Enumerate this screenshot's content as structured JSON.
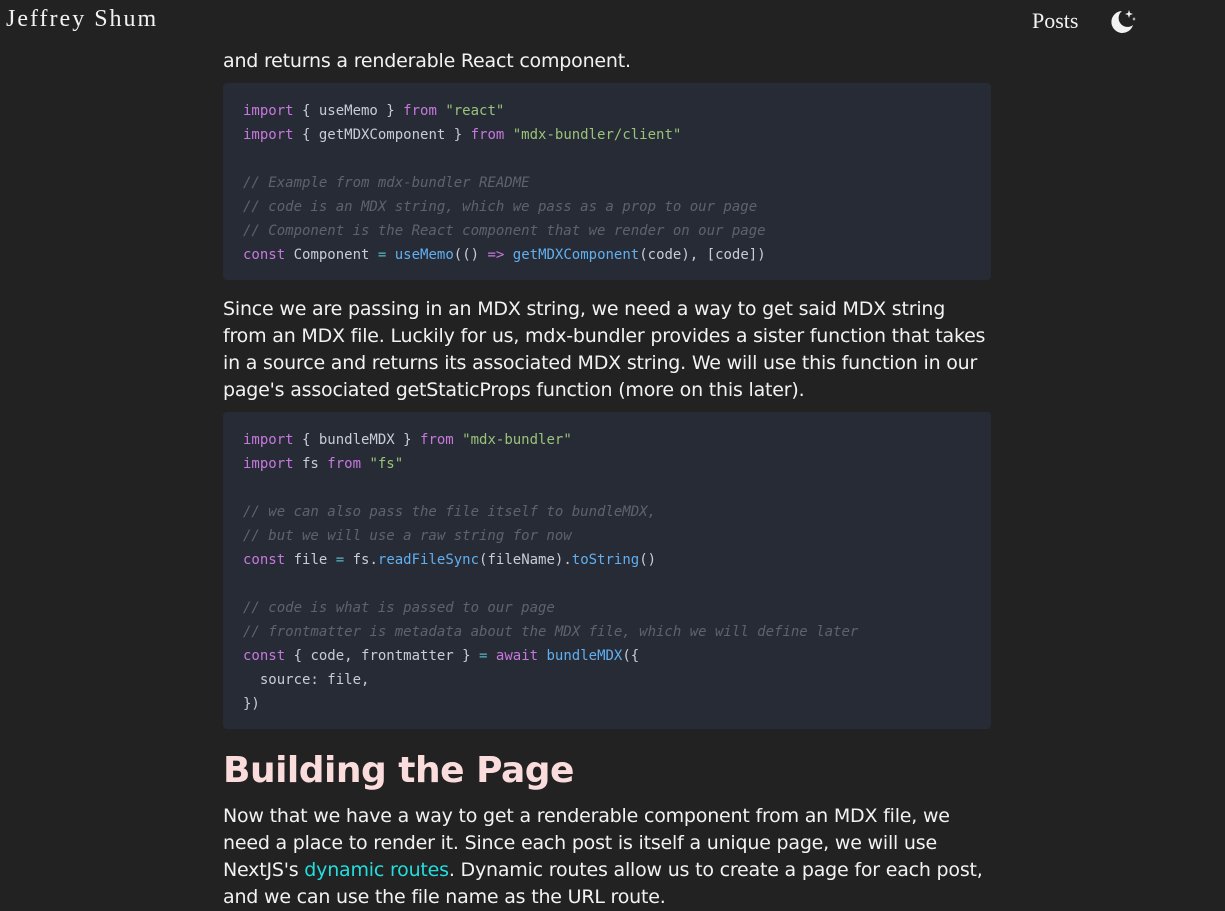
{
  "header": {
    "brand": "Jeffrey Shum",
    "nav_posts": "Posts",
    "theme_icon": "moon-stars-icon"
  },
  "article": {
    "intro_tail": "and returns a renderable React component.",
    "paragraph_mdx_string": "Since we are passing in an MDX string, we need a way to get said MDX string from an MDX file. Luckily for us, mdx-bundler provides a sister function that takes in a source and returns its associated MDX string. We will use this function in our page's associated getStaticProps function (more on this later).",
    "heading_building": "Building the Page",
    "paragraph_building_before": "Now that we have a way to get a renderable component from an MDX file, we need a place to render it. Since each post is itself a unique page, we will use NextJS's ",
    "paragraph_building_link": "dynamic routes",
    "paragraph_building_after": ". Dynamic routes allow us to create a page for each post, and we can use the file name as the URL route."
  },
  "code_blocks": [
    {
      "lines": [
        "import { useMemo } from \"react\"",
        "import { getMDXComponent } from \"mdx-bundler/client\"",
        "",
        "// Example from mdx-bundler README",
        "// code is an MDX string, which we pass as a prop to our page",
        "// Component is the React component that we render on our page",
        "const Component = useMemo(() => getMDXComponent(code), [code])"
      ]
    },
    {
      "lines": [
        "import { bundleMDX } from \"mdx-bundler\"",
        "import fs from \"fs\"",
        "",
        "// we can also pass the file itself to bundleMDX,",
        "// but we will use a raw string for now",
        "const file = fs.readFileSync(fileName).toString()",
        "",
        "// code is what is passed to our page",
        "// frontmatter is metadata about the MDX file, which we will define later",
        "const { code, frontmatter } = await bundleMDX({",
        "  source: file,",
        "})"
      ]
    }
  ],
  "colors": {
    "background": "#222222",
    "code_background": "#272b35",
    "heading": "#fbdcdc",
    "link": "#22dede",
    "keyword": "#c678dd",
    "string": "#98c379",
    "comment": "#5c6370",
    "function": "#61afef"
  }
}
